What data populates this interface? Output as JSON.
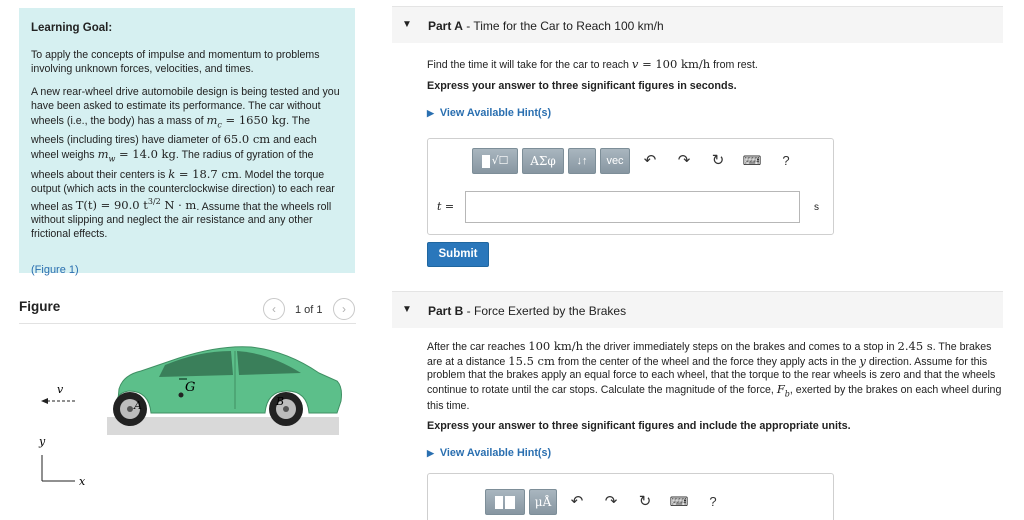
{
  "learning_goal": {
    "title": "Learning Goal:",
    "intro": "To apply the concepts of impulse and momentum to problems involving unknown forces, velocities, and times.",
    "p1_a": "A new rear-wheel drive automobile design is being tested and you have been asked to estimate its performance. The car without wheels (i.e., the body) has a mass of",
    "p1_mc": "m",
    "p1_mc_sub": "c",
    "p1_mc_val": " = 1650 kg",
    "p1_b": ". The wheels (including tires) have diameter of",
    "p1_diam": "65.0 cm",
    "p1_c": "and each wheel weighs",
    "p1_mw": "m",
    "p1_mw_sub": "w",
    "p1_mw_val": " = 14.0 kg",
    "p1_d": ". The radius of gyration of the wheels about their centers is",
    "p1_k": "k",
    "p1_k_val": " = 18.7 cm",
    "p1_e": ". Model the torque output (which acts in the counterclockwise direction) to each rear wheel as",
    "p1_T": "T(t) = 90.0 t",
    "p1_T_exp": "3/2",
    "p1_T_unit": " N · m",
    "p1_f": ". Assume that the wheels roll without slipping and neglect the air resistance and any other frictional effects.",
    "figure_link": "(Figure 1)",
    "figure_link_text": "Figure 1"
  },
  "figure_panel": {
    "title": "Figure",
    "counter": "1 of 1",
    "prev_icon": "chevron-left-icon",
    "next_icon": "chevron-right-icon",
    "label_v": "v",
    "label_G": "G",
    "label_A": "A",
    "label_B": "B",
    "label_y": "y",
    "label_x": "x",
    "car_color": "#5cbf8a"
  },
  "part_a": {
    "part_label": "Part A",
    "title": " - Time for the Car to Reach 100 km/h",
    "question_a": "Find the time it will take for the car to reach",
    "question_v": "v",
    "question_val": " = 100 km/h",
    "question_b": "from rest.",
    "instruction": "Express your answer to three significant figures in seconds.",
    "hint_link": "View Available Hint(s)",
    "toolbar": {
      "templates": "templates",
      "greek": "ΑΣφ",
      "arrows": "↓↑",
      "vec": "vec",
      "undo_icon": "undo-icon",
      "redo_icon": "redo-icon",
      "reset_icon": "reset-icon",
      "keyboard_icon": "keyboard-icon",
      "help": "?"
    },
    "var_label": "t",
    "var_eq": " =",
    "input_value": "",
    "unit": "s",
    "submit": "Submit"
  },
  "part_b": {
    "part_label": "Part B",
    "title": " - Force Exerted by the Brakes",
    "q1": "After the car reaches",
    "q1_val": "100 km/h",
    "q2": "the driver immediately steps on the brakes and comes to a stop in",
    "q2_val": "2.45 s",
    "q3": ". The brakes are at a distance",
    "q3_val": "15.5 cm",
    "q4": "from the center of the wheel and the force they apply acts in the",
    "q4_y": "y",
    "q5": "direction. Assume for this problem that the brakes apply an equal force to each wheel, that the torque to the rear wheels is zero and that the wheels continue to rotate until the car stops. Calculate the magnitude of the force,",
    "q5_F": "F",
    "q5_F_sub": "b",
    "q6": ", exerted by the brakes on each wheel during this time.",
    "instruction": "Express your answer to three significant figures and include the appropriate units.",
    "hint_link": "View Available Hint(s)",
    "toolbar": {
      "templates": "templates",
      "units": "μÅ",
      "undo_icon": "undo-icon",
      "redo_icon": "redo-icon",
      "reset_icon": "reset-icon",
      "keyboard_icon": "keyboard-icon",
      "help": "?"
    }
  }
}
